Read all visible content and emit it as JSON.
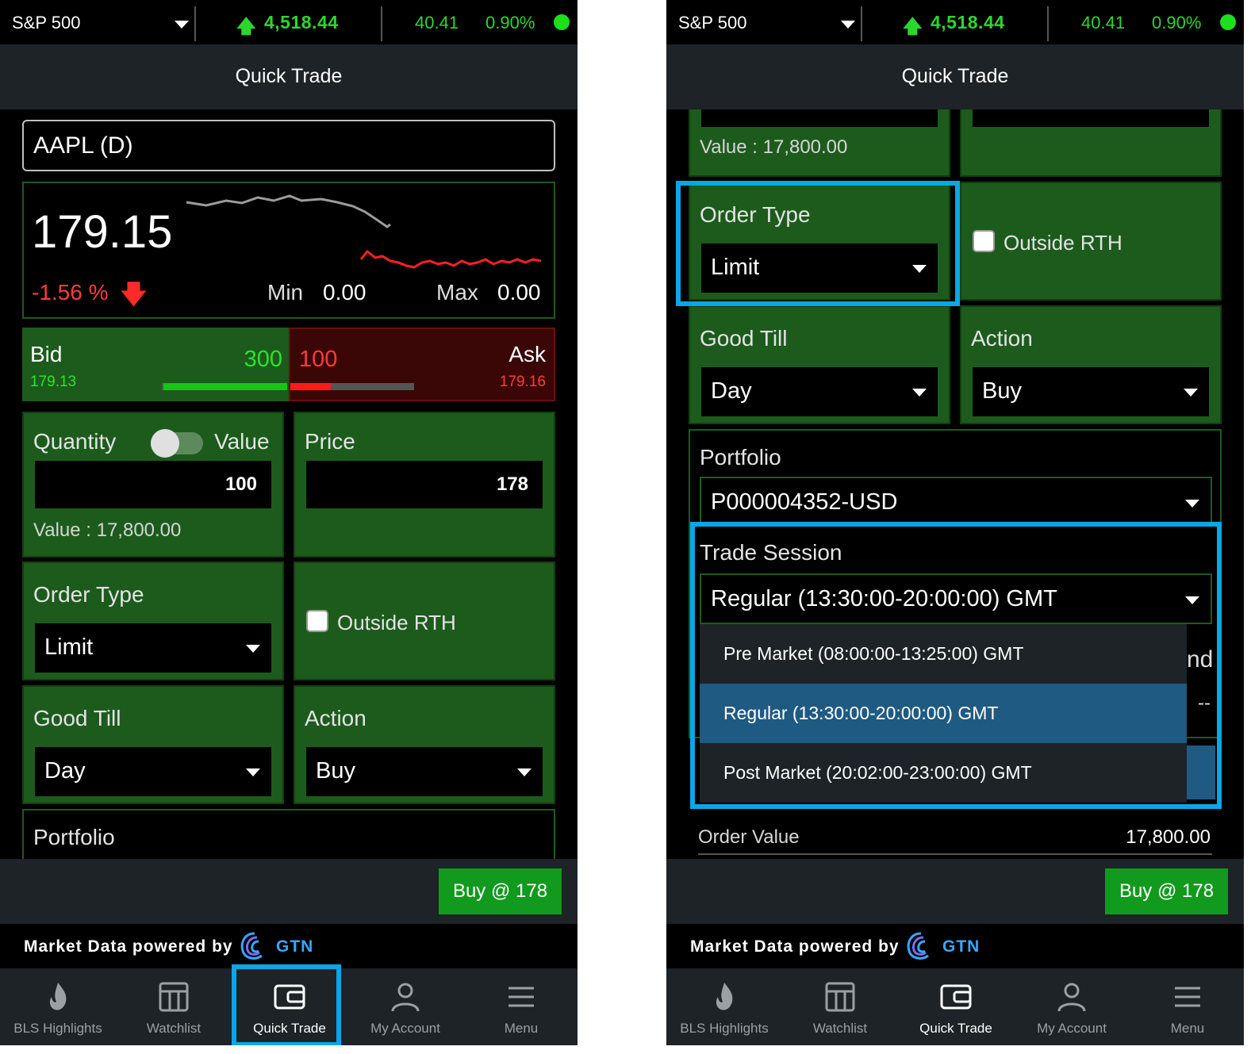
{
  "ticker": {
    "index_name": "S&P 500",
    "up_arrow": "🡅",
    "value": "4,518.44",
    "change": "40.41",
    "change_pct": "0.90%"
  },
  "title": "Quick Trade",
  "symbol": "AAPL (D)",
  "quote": {
    "last": "179.15",
    "change_pct": "-1.56 %",
    "down_arrow": "🡇",
    "min_label": "Min",
    "min_value": "0.00",
    "max_label": "Max",
    "max_value": "0.00"
  },
  "bid": {
    "label": "Bid",
    "price": "179.13",
    "qty": "300",
    "depth_fraction": 0.99
  },
  "ask": {
    "label": "Ask",
    "price": "179.16",
    "qty": "100",
    "depth_fraction": 0.33
  },
  "quantity": {
    "label": "Quantity",
    "toggle_label": "Value",
    "value": "100",
    "value_text": "Value : 17,800.00"
  },
  "price": {
    "label": "Price",
    "value": "178"
  },
  "order_type": {
    "label": "Order Type",
    "value": "Limit"
  },
  "outside_rth": {
    "label": "Outside RTH",
    "checked": false
  },
  "good_till": {
    "label": "Good Till",
    "value": "Day"
  },
  "action": {
    "label": "Action",
    "value": "Buy"
  },
  "portfolio": {
    "label": "Portfolio",
    "value": "P000004352-USD"
  },
  "trade_session": {
    "label": "Trade Session",
    "value": "Regular (13:30:00-20:00:00) GMT",
    "options": [
      "Pre Market (08:00:00-13:25:00) GMT",
      "Regular (13:30:00-20:00:00) GMT",
      "Post Market (20:02:00-23:00:00) GMT"
    ],
    "selected_index": 1,
    "behind_text_1": "nd",
    "behind_text_2": "--"
  },
  "order_value": {
    "label": "Order Value",
    "value": "17,800.00"
  },
  "buy_button": "Buy @ 178",
  "powered": {
    "text": "Market Data powered by",
    "brand": "GTN"
  },
  "nav": [
    {
      "label": "BLS Highlights",
      "icon": "flame-icon"
    },
    {
      "label": "Watchlist",
      "icon": "watchlist-icon"
    },
    {
      "label": "Quick Trade",
      "icon": "wallet-icon"
    },
    {
      "label": "My Account",
      "icon": "person-icon"
    },
    {
      "label": "Menu",
      "icon": "menu-icon"
    }
  ],
  "colors": {
    "highlight": "#0aa7e6",
    "panel_green": "#1c5b1c",
    "up_green": "#2dd62d",
    "down_red": "#ff3b3b",
    "buy_button": "#119a1d",
    "selected_option": "#1f5a82"
  }
}
